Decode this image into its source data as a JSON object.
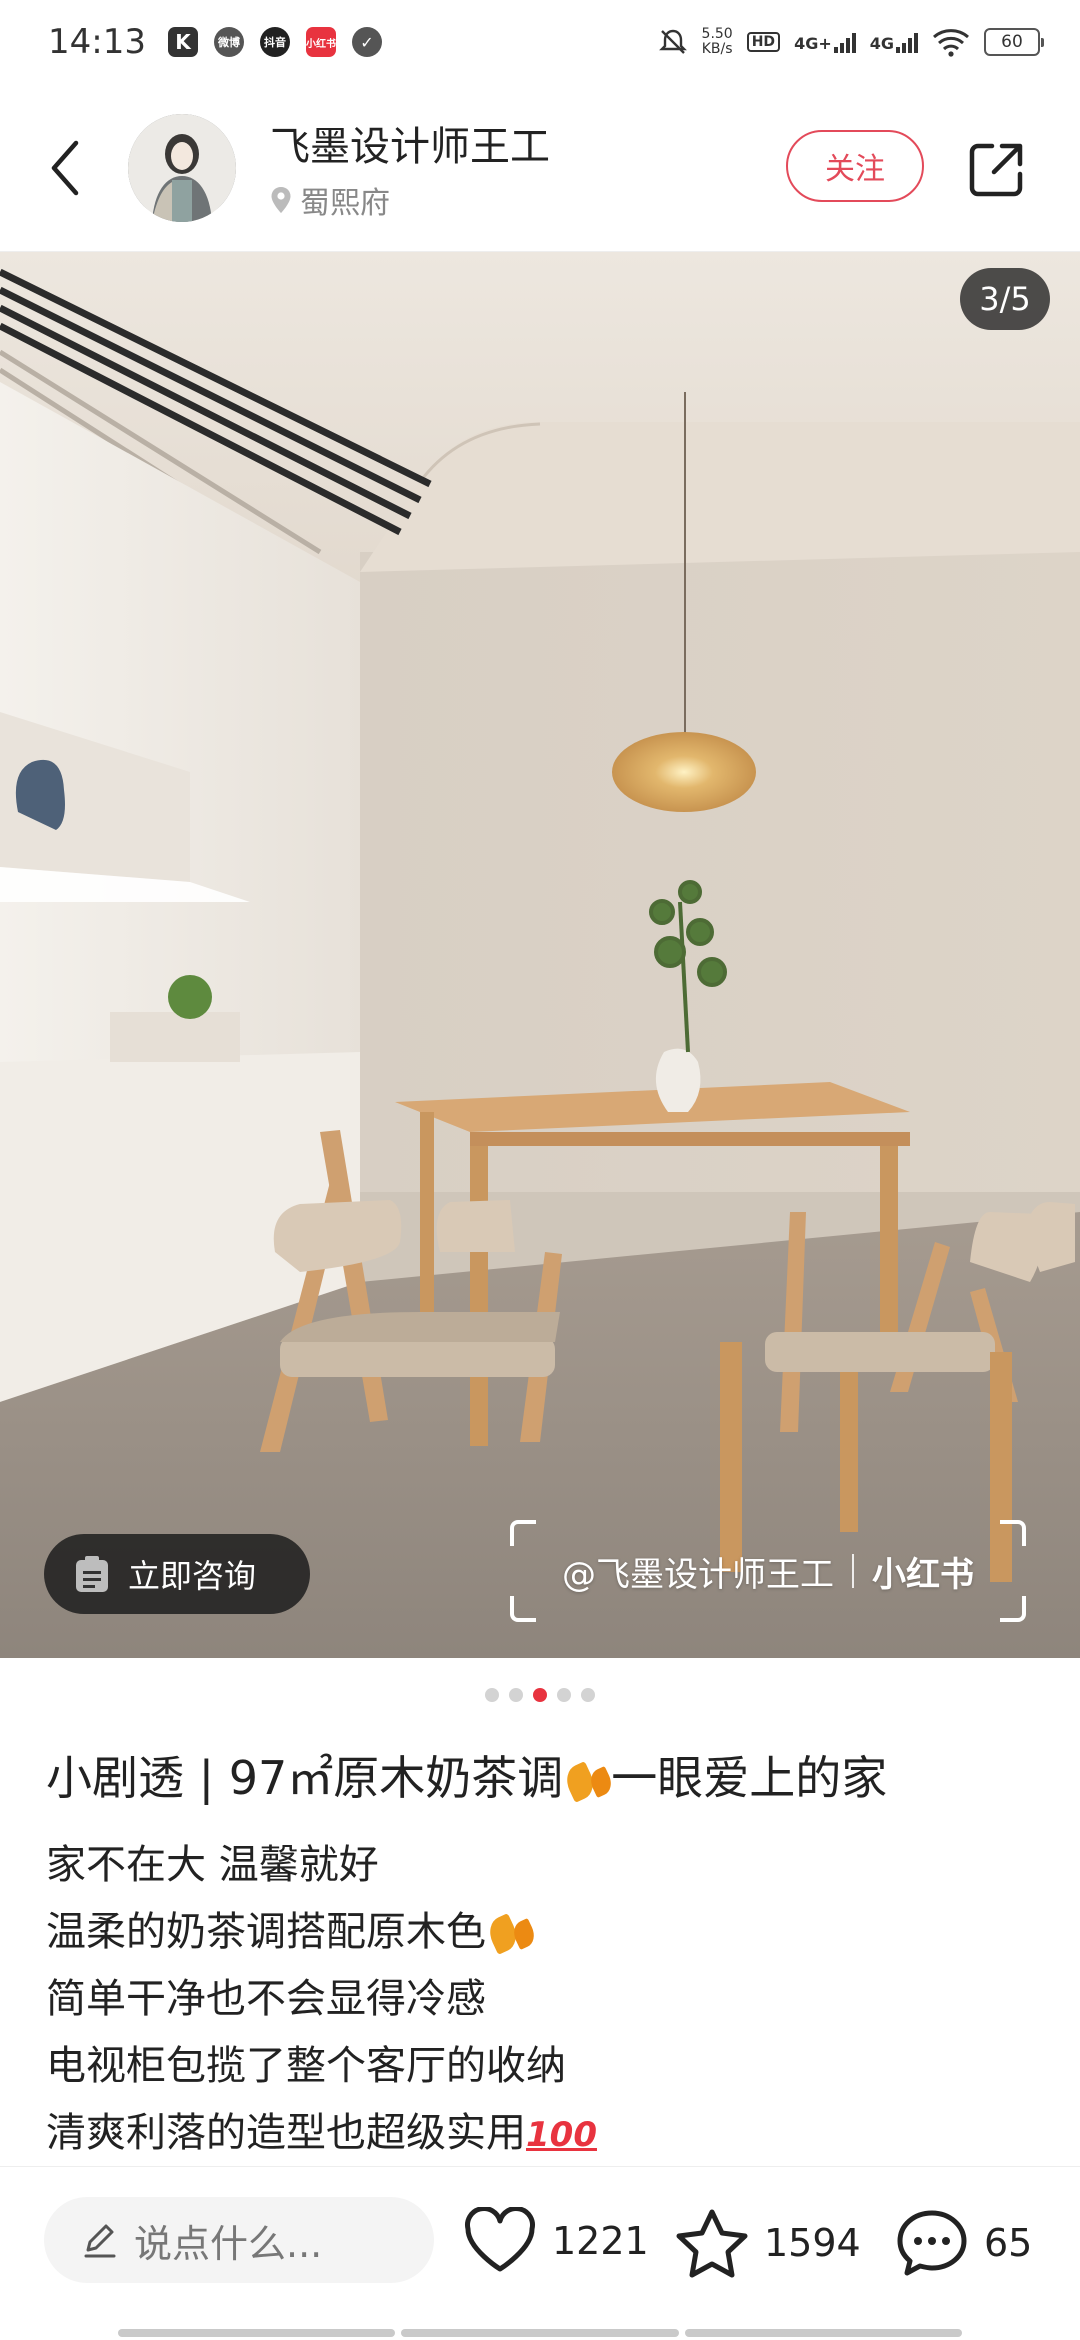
{
  "status_bar": {
    "time": "14:13",
    "apps": [
      "K",
      "微博",
      "抖音",
      "小红书",
      "✓"
    ],
    "net_speed_value": "5.50",
    "net_speed_unit": "KB/s",
    "hd": "HD",
    "sim1": "4G+",
    "sim2": "4G",
    "battery": "60"
  },
  "header": {
    "author_name": "飞墨设计师王工",
    "location": "蜀熙府",
    "follow_label": "关注"
  },
  "photo": {
    "page_counter": "3/5",
    "consult_label": "立即咨询",
    "watermark_author": "@飞墨设计师王工",
    "watermark_brand": "小红书"
  },
  "carousel": {
    "count": 5,
    "active_index": 3
  },
  "note": {
    "title_text": "小剧透 | 97㎡原木奶茶调",
    "title_suffix": "一眼爱上的家",
    "lines": [
      "家不在大 温馨就好",
      "温柔的奶茶调搭配原木色",
      "简单干净也不会显得冷感",
      "电视柜包揽了整个客厅的收纳",
      "清爽利落的造型也超级实用"
    ]
  },
  "bottom_bar": {
    "comment_placeholder": "说点什么...",
    "likes": "1221",
    "favorites": "1594",
    "comments": "65"
  },
  "colors": {
    "accent_red": "#e8333f",
    "follow_red": "#e34a5a",
    "leaf_orange": "#f0a020"
  },
  "icons": [
    "back-arrow-icon",
    "location-pin-icon",
    "share-icon",
    "clipboard-icon",
    "pencil-icon",
    "heart-icon",
    "star-icon",
    "comment-bubble-icon"
  ]
}
